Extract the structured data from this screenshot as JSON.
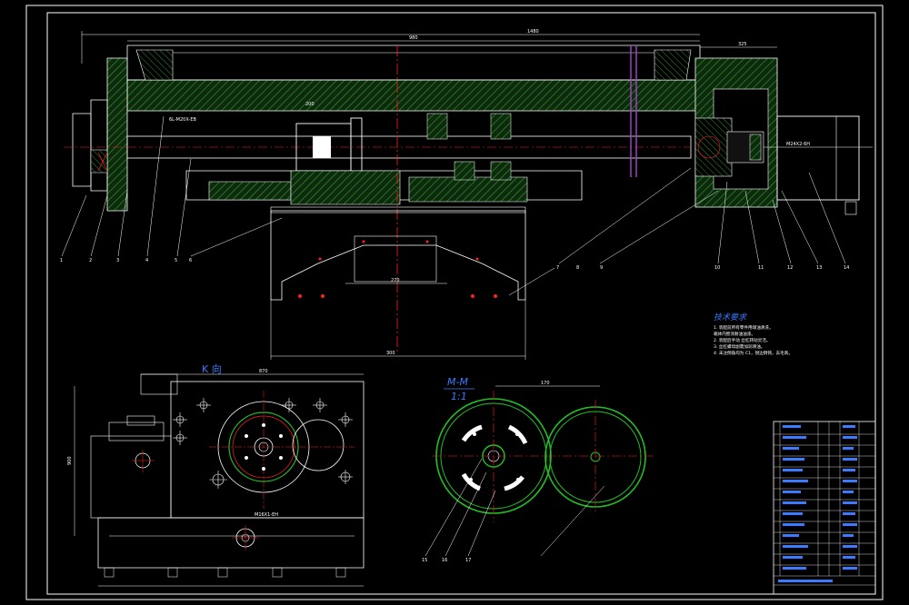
{
  "colors": {
    "background": "#000000",
    "outline": "#ffffff",
    "hatch": "#2f8f2f",
    "centerline": "#ff2020",
    "label_blue": "#3a7bff",
    "gear_green": "#22c022",
    "shaft_purple": "#a040c0"
  },
  "drawing": {
    "dimensions": {
      "top_overall": "1480",
      "top_left": "980",
      "top_right": "325",
      "base_width": "300",
      "slot_width": "270",
      "k_view_top": "870",
      "k_view_height": "900",
      "m_view_dim": "170"
    },
    "annotations": {
      "motor_spec": "M24X2-6H",
      "left_note": "6L-M20X-EB",
      "bottom_note": "M16X1-EH"
    },
    "tech_requirements": {
      "title": "技术要求",
      "lines": [
        "1. 装配前所有零件用煤油清洗，",
        "   箱体内壁涂耐油油漆。",
        "2. 装配后手动 丝杠转动灵活。",
        "3. 丝杠螺母副需加润滑油。",
        "4. 未注倒角均为 C1，锐边倒钝，去毛刺。"
      ]
    },
    "views": {
      "k_view_label": "K 向",
      "m_view_label": "M-M",
      "m_view_scale": "1:1"
    },
    "part_numbers": [
      "1",
      "2",
      "3",
      "4",
      "5",
      "6",
      "7",
      "8",
      "9",
      "10",
      "11",
      "12",
      "13",
      "14",
      "15",
      "16",
      "17"
    ]
  }
}
